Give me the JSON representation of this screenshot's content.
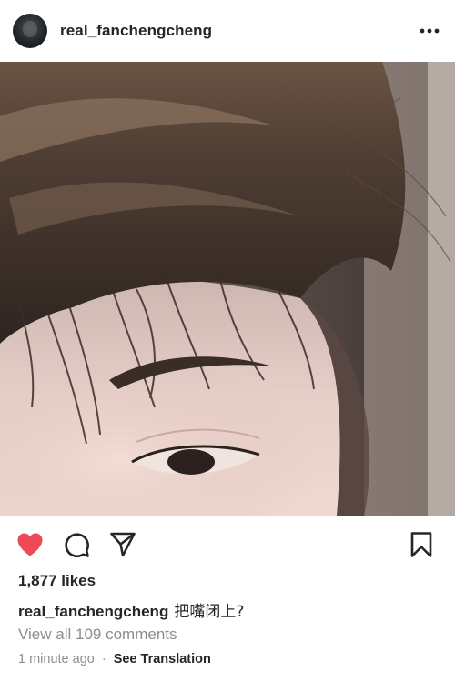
{
  "post": {
    "username": "real_fanchengcheng",
    "avatar_icon": "profile-avatar",
    "more_icon": "more-horizontal-icon",
    "photo_description_icon": "selfie-photo",
    "actions": {
      "like_icon": "heart-filled-icon",
      "like_color": "#ed4956",
      "comment_icon": "comment-bubble-icon",
      "share_icon": "paper-plane-icon",
      "save_icon": "bookmark-icon"
    },
    "likes_text": "1,877 likes",
    "caption": {
      "username": "real_fanchengcheng",
      "text": "把嘴闭上?"
    },
    "comments_link": "View all 109 comments",
    "timestamp": "1 minute ago",
    "separator": "·",
    "translate_label": "See Translation"
  }
}
